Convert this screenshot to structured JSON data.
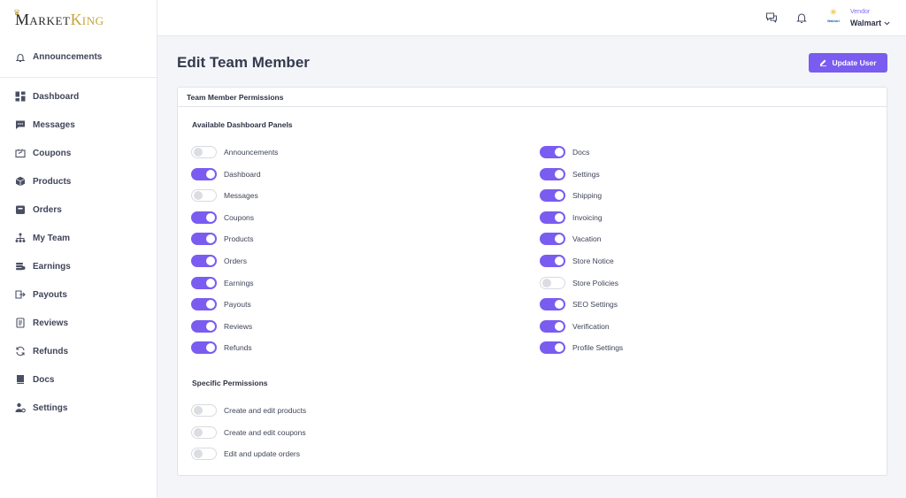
{
  "brand": {
    "logo_big_m": "M",
    "logo_small_arket": "ARKET",
    "logo_big_k": "K",
    "logo_small_ing": "ING"
  },
  "sidebar": {
    "announcements": {
      "label": "Announcements",
      "icon": "bell-icon"
    },
    "items": [
      {
        "label": "Dashboard",
        "icon": "grid-icon"
      },
      {
        "label": "Messages",
        "icon": "chat-icon"
      },
      {
        "label": "Coupons",
        "icon": "coupon-icon"
      },
      {
        "label": "Products",
        "icon": "box-icon"
      },
      {
        "label": "Orders",
        "icon": "orders-icon"
      },
      {
        "label": "My Team",
        "icon": "team-icon"
      },
      {
        "label": "Earnings",
        "icon": "coins-icon"
      },
      {
        "label": "Payouts",
        "icon": "payout-icon"
      },
      {
        "label": "Reviews",
        "icon": "reviews-icon"
      },
      {
        "label": "Refunds",
        "icon": "refresh-icon"
      },
      {
        "label": "Docs",
        "icon": "book-icon"
      },
      {
        "label": "Settings",
        "icon": "user-gear-icon"
      }
    ]
  },
  "header": {
    "vendor_role": "Vendor",
    "vendor_name": "Walmart",
    "vendor_logo_text": "Walmart"
  },
  "page": {
    "title": "Edit Team Member",
    "update_button": "Update User",
    "card_title": "Team Member Permissions",
    "panels_title": "Available Dashboard Panels",
    "specific_title": "Specific Permissions"
  },
  "panels_left": [
    {
      "label": "Announcements",
      "on": false
    },
    {
      "label": "Dashboard",
      "on": true
    },
    {
      "label": "Messages",
      "on": false
    },
    {
      "label": "Coupons",
      "on": true
    },
    {
      "label": "Products",
      "on": true
    },
    {
      "label": "Orders",
      "on": true
    },
    {
      "label": "Earnings",
      "on": true
    },
    {
      "label": "Payouts",
      "on": true
    },
    {
      "label": "Reviews",
      "on": true
    },
    {
      "label": "Refunds",
      "on": true
    }
  ],
  "panels_right": [
    {
      "label": "Docs",
      "on": true
    },
    {
      "label": "Settings",
      "on": true
    },
    {
      "label": "Shipping",
      "on": true
    },
    {
      "label": "Invoicing",
      "on": true
    },
    {
      "label": "Vacation",
      "on": true
    },
    {
      "label": "Store Notice",
      "on": true
    },
    {
      "label": "Store Policies",
      "on": false
    },
    {
      "label": "SEO Settings",
      "on": true
    },
    {
      "label": "Verification",
      "on": true
    },
    {
      "label": "Profile Settings",
      "on": true
    }
  ],
  "specific": [
    {
      "label": "Create and edit products",
      "on": false
    },
    {
      "label": "Create and edit coupons",
      "on": false
    },
    {
      "label": "Edit and update orders",
      "on": false
    }
  ],
  "colors": {
    "accent": "#7a5cf0",
    "gold": "#c6a43a"
  }
}
